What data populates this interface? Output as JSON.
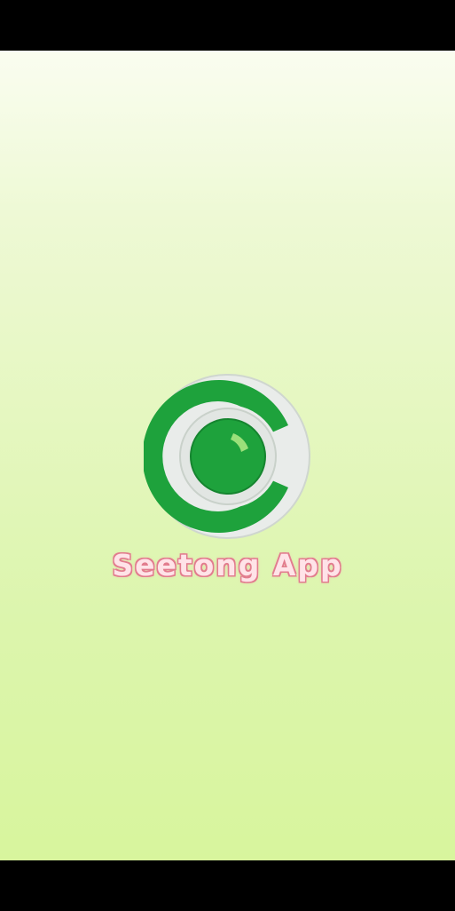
{
  "app": {
    "name": "Seetong App"
  },
  "logo": {
    "icon": "seetong-camera-logo-icon",
    "colors": {
      "ring": "#d0d8d0",
      "outer_disc": "#e9ecea",
      "c_shape": "#1ea23c",
      "lens": "#1ea23c",
      "lens_highlight": "#9be07a"
    }
  },
  "theme": {
    "background_top": "#fafdf0",
    "background_bottom": "#d8f59d",
    "text_fill": "#ffe3e8",
    "text_outline": "#e27c8e",
    "system_bars": "#000000"
  }
}
